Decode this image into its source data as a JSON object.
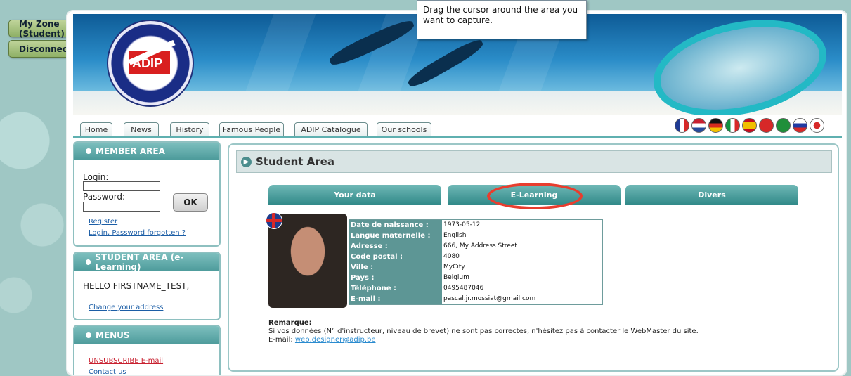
{
  "side_buttons": {
    "my_zone": "My Zone (Student)",
    "disconnect": "Disconnect"
  },
  "tooltip": {
    "text": "Drag the cursor around the area you want to capture."
  },
  "logo": {
    "text": "ADIP"
  },
  "nav": {
    "tabs": [
      "Home",
      "News",
      "History",
      "Famous People",
      "ADIP Catalogue",
      "Our schools"
    ],
    "flags": [
      "french-flag-icon",
      "dutch-flag-icon",
      "german-flag-icon",
      "italian-flag-icon",
      "spanish-flag-icon",
      "taiwan-flag-icon",
      "arabic-flag-icon",
      "russian-flag-icon",
      "japanese-flag-icon"
    ]
  },
  "member_area": {
    "title": "MEMBER AREA",
    "login_label": "Login:",
    "password_label": "Password:",
    "ok_button": "OK",
    "register_link": "Register",
    "forgot_link": "Login, Password forgotten ?"
  },
  "student_area": {
    "title": "STUDENT AREA (e-Learning)",
    "greeting": "HELLO FIRSTNAME_TEST,",
    "change_address_link": "Change your address"
  },
  "menus": {
    "title": "MENUS",
    "unsubscribe": "UNSUBSCRIBE E-mail",
    "contact": "Contact us"
  },
  "main": {
    "title": "Student Area",
    "tabs": [
      "Your data",
      "E-Learning",
      "Divers"
    ],
    "info": [
      {
        "label": "Date de naissance :",
        "value": "1973-05-12"
      },
      {
        "label": "Langue maternelle :",
        "value": "English"
      },
      {
        "label": "Adresse :",
        "value": "666, My Address Street"
      },
      {
        "label": "Code postal :",
        "value": "4080"
      },
      {
        "label": "Ville :",
        "value": "MyCity"
      },
      {
        "label": "Pays :",
        "value": "Belgium"
      },
      {
        "label": "Téléphone :",
        "value": "0495487046"
      },
      {
        "label": "E-mail :",
        "value": "pascal.jr.mossiat@gmail.com"
      }
    ],
    "remark_title": "Remarque:",
    "remark_text": "Si vos données (N° d'instructeur, niveau de brevet) ne sont pas correctes, n'hésitez pas à contacter le WebMaster du site.",
    "email_label": "E-mail:",
    "email_link": "web.designer@adip.be"
  },
  "colors": {
    "accent": "#4d9b9b",
    "highlight_circle": "#e83d2e",
    "link": "#1c5ea6"
  }
}
